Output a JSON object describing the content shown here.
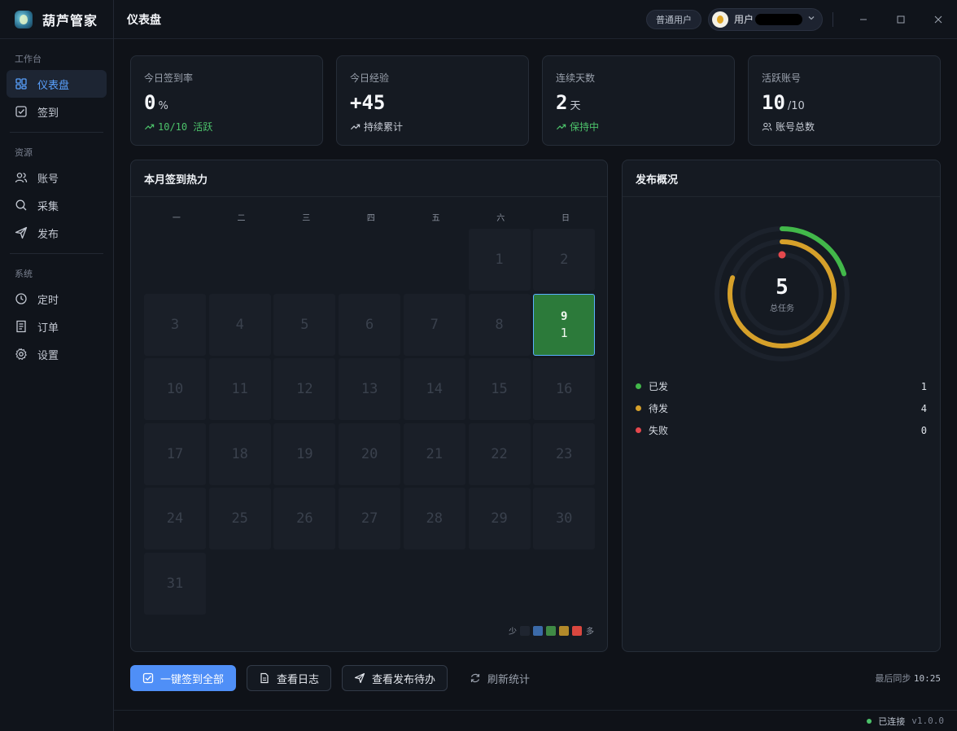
{
  "app": {
    "name": "葫芦管家"
  },
  "sidebar": {
    "sections": [
      {
        "title": "工作台",
        "items": [
          {
            "label": "仪表盘",
            "icon": "dashboard-icon",
            "active": true
          },
          {
            "label": "签到",
            "icon": "checkin-icon"
          }
        ]
      },
      {
        "title": "资源",
        "items": [
          {
            "label": "账号",
            "icon": "users-icon"
          },
          {
            "label": "采集",
            "icon": "search-icon"
          },
          {
            "label": "发布",
            "icon": "send-icon"
          }
        ]
      },
      {
        "title": "系统",
        "items": [
          {
            "label": "定时",
            "icon": "clock-icon"
          },
          {
            "label": "订单",
            "icon": "receipt-icon"
          },
          {
            "label": "设置",
            "icon": "gear-icon"
          }
        ]
      }
    ]
  },
  "header": {
    "title": "仪表盘",
    "role_badge": "普通用户",
    "user_name": "用户"
  },
  "stats": [
    {
      "label": "今日签到率",
      "value": "0",
      "unit": "%",
      "sub": "10/10 活跃",
      "sub_icon": "trend-up-icon",
      "sub_color": "#4cc26a"
    },
    {
      "label": "今日经验",
      "value": "+45",
      "unit": "",
      "sub": "持续累计",
      "sub_icon": "trend-up-icon",
      "sub_color": "#c7ccd5"
    },
    {
      "label": "连续天数",
      "value": "2",
      "unit": "天",
      "sub": "保持中",
      "sub_icon": "trend-up-icon",
      "sub_color": "#4cc26a"
    },
    {
      "label": "活跃账号",
      "value": "10",
      "unit": "/10",
      "sub": "账号总数",
      "sub_icon": "users-icon",
      "sub_color": "#c7ccd5"
    }
  ],
  "heatmap": {
    "title": "本月签到热力",
    "weekdays": [
      "一",
      "二",
      "三",
      "四",
      "五",
      "六",
      "日"
    ],
    "first_weekday_index": 5,
    "days_in_month": 31,
    "today": {
      "day": "9",
      "count": "1"
    },
    "scale": {
      "less": "少",
      "more": "多",
      "colors": [
        "#1f2530",
        "#3b6aa8",
        "#3f8a45",
        "#b38a2a",
        "#d9473f"
      ]
    }
  },
  "publish": {
    "title": "发布概况",
    "total": "5",
    "total_label": "总任务",
    "items": [
      {
        "label": "已发",
        "count": "1",
        "color": "#42b84a"
      },
      {
        "label": "待发",
        "count": "4",
        "color": "#d6a02a"
      },
      {
        "label": "失败",
        "count": "0",
        "color": "#e5484d"
      }
    ]
  },
  "actions": {
    "checkin_all": "一键签到全部",
    "view_logs": "查看日志",
    "view_pending": "查看发布待办",
    "refresh": "刷新统计",
    "sync_label": "最后同步",
    "sync_time": "10:25"
  },
  "status": {
    "connection": "已连接",
    "version": "v1.0.0"
  }
}
